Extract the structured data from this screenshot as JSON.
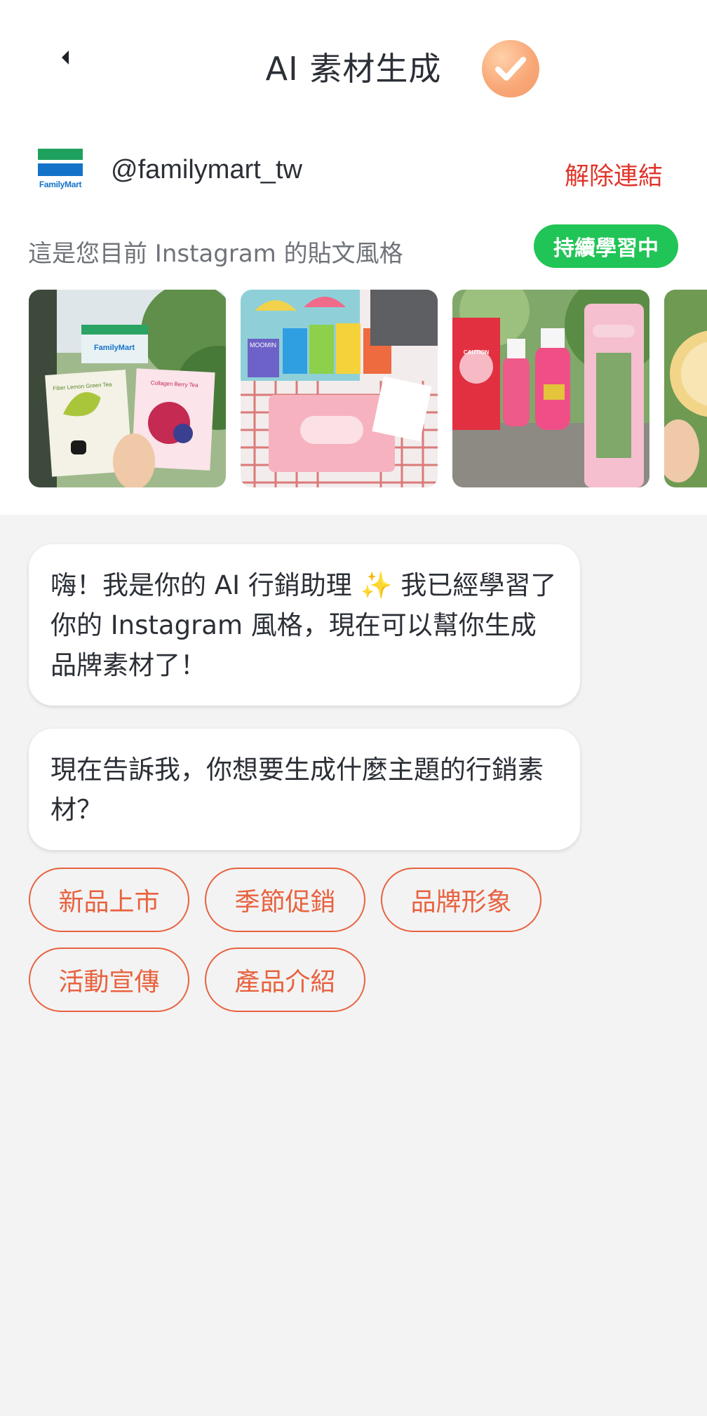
{
  "header": {
    "title": "AI 素材生成",
    "back_icon": "chevron-left-icon",
    "status_icon": "check-icon"
  },
  "account": {
    "logo_text": "FamilyMart",
    "handle": "@familymart_tw",
    "unlink_label": "解除連結"
  },
  "style_section": {
    "label": "這是您目前 Instagram 的貼文風格",
    "badge": "持續學習中"
  },
  "thumbnails": {
    "t1_sign": "FamilyMart",
    "t1_box_left": "Fiber Lemon Green Tea",
    "t1_box_right": "Collagen Berry Tea",
    "t2_box": "MOOMIN",
    "t3_bag": "CAUTION"
  },
  "chat": {
    "message1": "嗨！我是你的 AI 行銷助理 ✨ 我已經學習了你的 Instagram 風格，現在可以幫你生成品牌素材了！",
    "message2": "現在告訴我，你想要生成什麼主題的行銷素材？"
  },
  "options": [
    "新品上市",
    "季節促銷",
    "品牌形象",
    "活動宣傳",
    "產品介紹"
  ],
  "colors": {
    "accent": "#e8623f",
    "badge_green": "#21c456",
    "unlink_red": "#e0352b",
    "brand_green": "#1fa15e",
    "brand_blue": "#1473c9"
  }
}
